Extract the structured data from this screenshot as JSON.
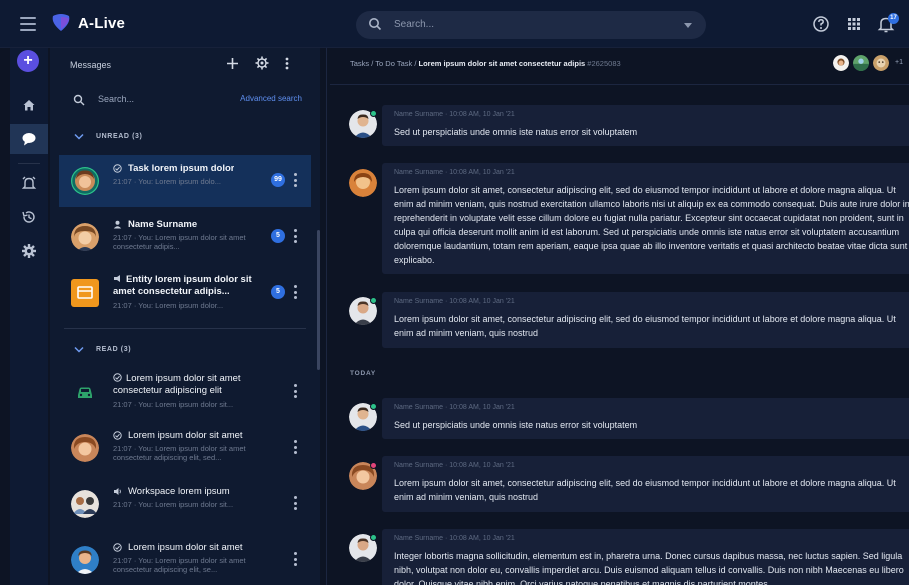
{
  "app": {
    "title": "A-Live"
  },
  "topbar": {
    "search_placeholder": "Search...",
    "notification_count": "17"
  },
  "messages": {
    "header": "Messages",
    "search_placeholder": "Search...",
    "advanced_search": "Advanced search",
    "unread_label": "UNREAD (3)",
    "read_label": "READ (3)",
    "unread": [
      {
        "title": "Task lorem ipsum dolor",
        "sub": "21:07 · You: Lorem ipsum dolo...",
        "badge": "99"
      },
      {
        "title": "Name Surname",
        "sub": "21:07 · You: Lorem ipsum dolor sit amet consectetur adipis...",
        "badge": "5"
      },
      {
        "title": "Entity lorem ipsum dolor sit amet consectetur adipis...",
        "sub": "21:07 · You: Lorem ipsum dolor...",
        "badge": "5"
      }
    ],
    "read": [
      {
        "title": "Lorem ipsum dolor sit amet consectetur adipiscing elit",
        "sub": "21:07 · You: Lorem ipsum dolor sit..."
      },
      {
        "title": "Lorem ipsum dolor sit amet",
        "sub": "21:07 · You: Lorem ipsum dolor sit amet consectetur adipiscing elit, sed..."
      },
      {
        "title": "Workspace lorem ipsum",
        "sub": "21:07 · You: Lorem ipsum dolor sit..."
      },
      {
        "title": "Lorem ipsum dolor sit amet",
        "sub": "21:07 · You: Lorem ipsum dolor sit amet consectetur adipiscing elit, se..."
      }
    ]
  },
  "chat": {
    "breadcrumb_prefix": "Tasks / To Do Task / ",
    "breadcrumb_title": "Lorem ipsum dolor sit amet consectetur adipis",
    "breadcrumb_id": "#2625083",
    "participants_more": "+1",
    "day_label": "TODAY",
    "messages": [
      {
        "meta": "Name Surname · 10:08 AM, 10 Jan '21",
        "text": "Sed ut perspiciatis unde omnis iste natus error sit voluptatem"
      },
      {
        "meta": "Name Surname · 10:08 AM, 10 Jan '21",
        "text": "Lorem ipsum dolor sit amet, consectetur adipiscing elit, sed do eiusmod tempor incididunt ut labore et dolore magna aliqua. Ut enim ad minim veniam, quis nostrud exercitation ullamco laboris nisi ut aliquip ex ea commodo consequat. Duis aute irure dolor in reprehenderit in voluptate velit esse cillum dolore eu fugiat nulla pariatur. Excepteur sint occaecat cupidatat non proident, sunt in culpa qui officia deserunt mollit anim id est laborum. Sed ut perspiciatis unde omnis iste natus error sit voluptatem accusantium doloremque laudantium, totam rem aperiam, eaque ipsa quae ab illo inventore veritatis et quasi architecto beatae vitae dicta sunt explicabo."
      },
      {
        "meta": "Name Surname · 10:08 AM, 10 Jan '21",
        "text": "Lorem ipsum dolor sit amet, consectetur adipiscing elit, sed do eiusmod tempor incididunt ut labore et dolore magna aliqua. Ut enim ad minim veniam, quis nostrud"
      },
      {
        "meta": "Name Surname · 10:08 AM, 10 Jan '21",
        "text": "Sed ut perspiciatis unde omnis iste natus error sit voluptatem"
      },
      {
        "meta": "Name Surname · 10:08 AM, 10 Jan '21",
        "text": "Lorem ipsum dolor sit amet, consectetur adipiscing elit, sed do eiusmod tempor incididunt ut labore et dolore magna aliqua. Ut enim ad minim veniam, quis nostrud"
      },
      {
        "meta": "Name Surname · 10:08 AM, 10 Jan '21",
        "text": "Integer lobortis magna sollicitudin, elementum est in, pharetra urna. Donec cursus dapibus massa, nec luctus sapien. Sed ligula nibh, volutpat non dolor eu, convallis imperdiet arcu. Duis euismod aliquam tellus id convallis. Duis non nibh Maecenas eu libero dolor. Quisque vitae nibh enim. Orci varius natoque penatibus et magnis dis parturient montes."
      }
    ]
  },
  "colors": {
    "accent": "#2f6fe0",
    "rail_add": "#5b4fe0",
    "presence": "#2cc28a"
  }
}
